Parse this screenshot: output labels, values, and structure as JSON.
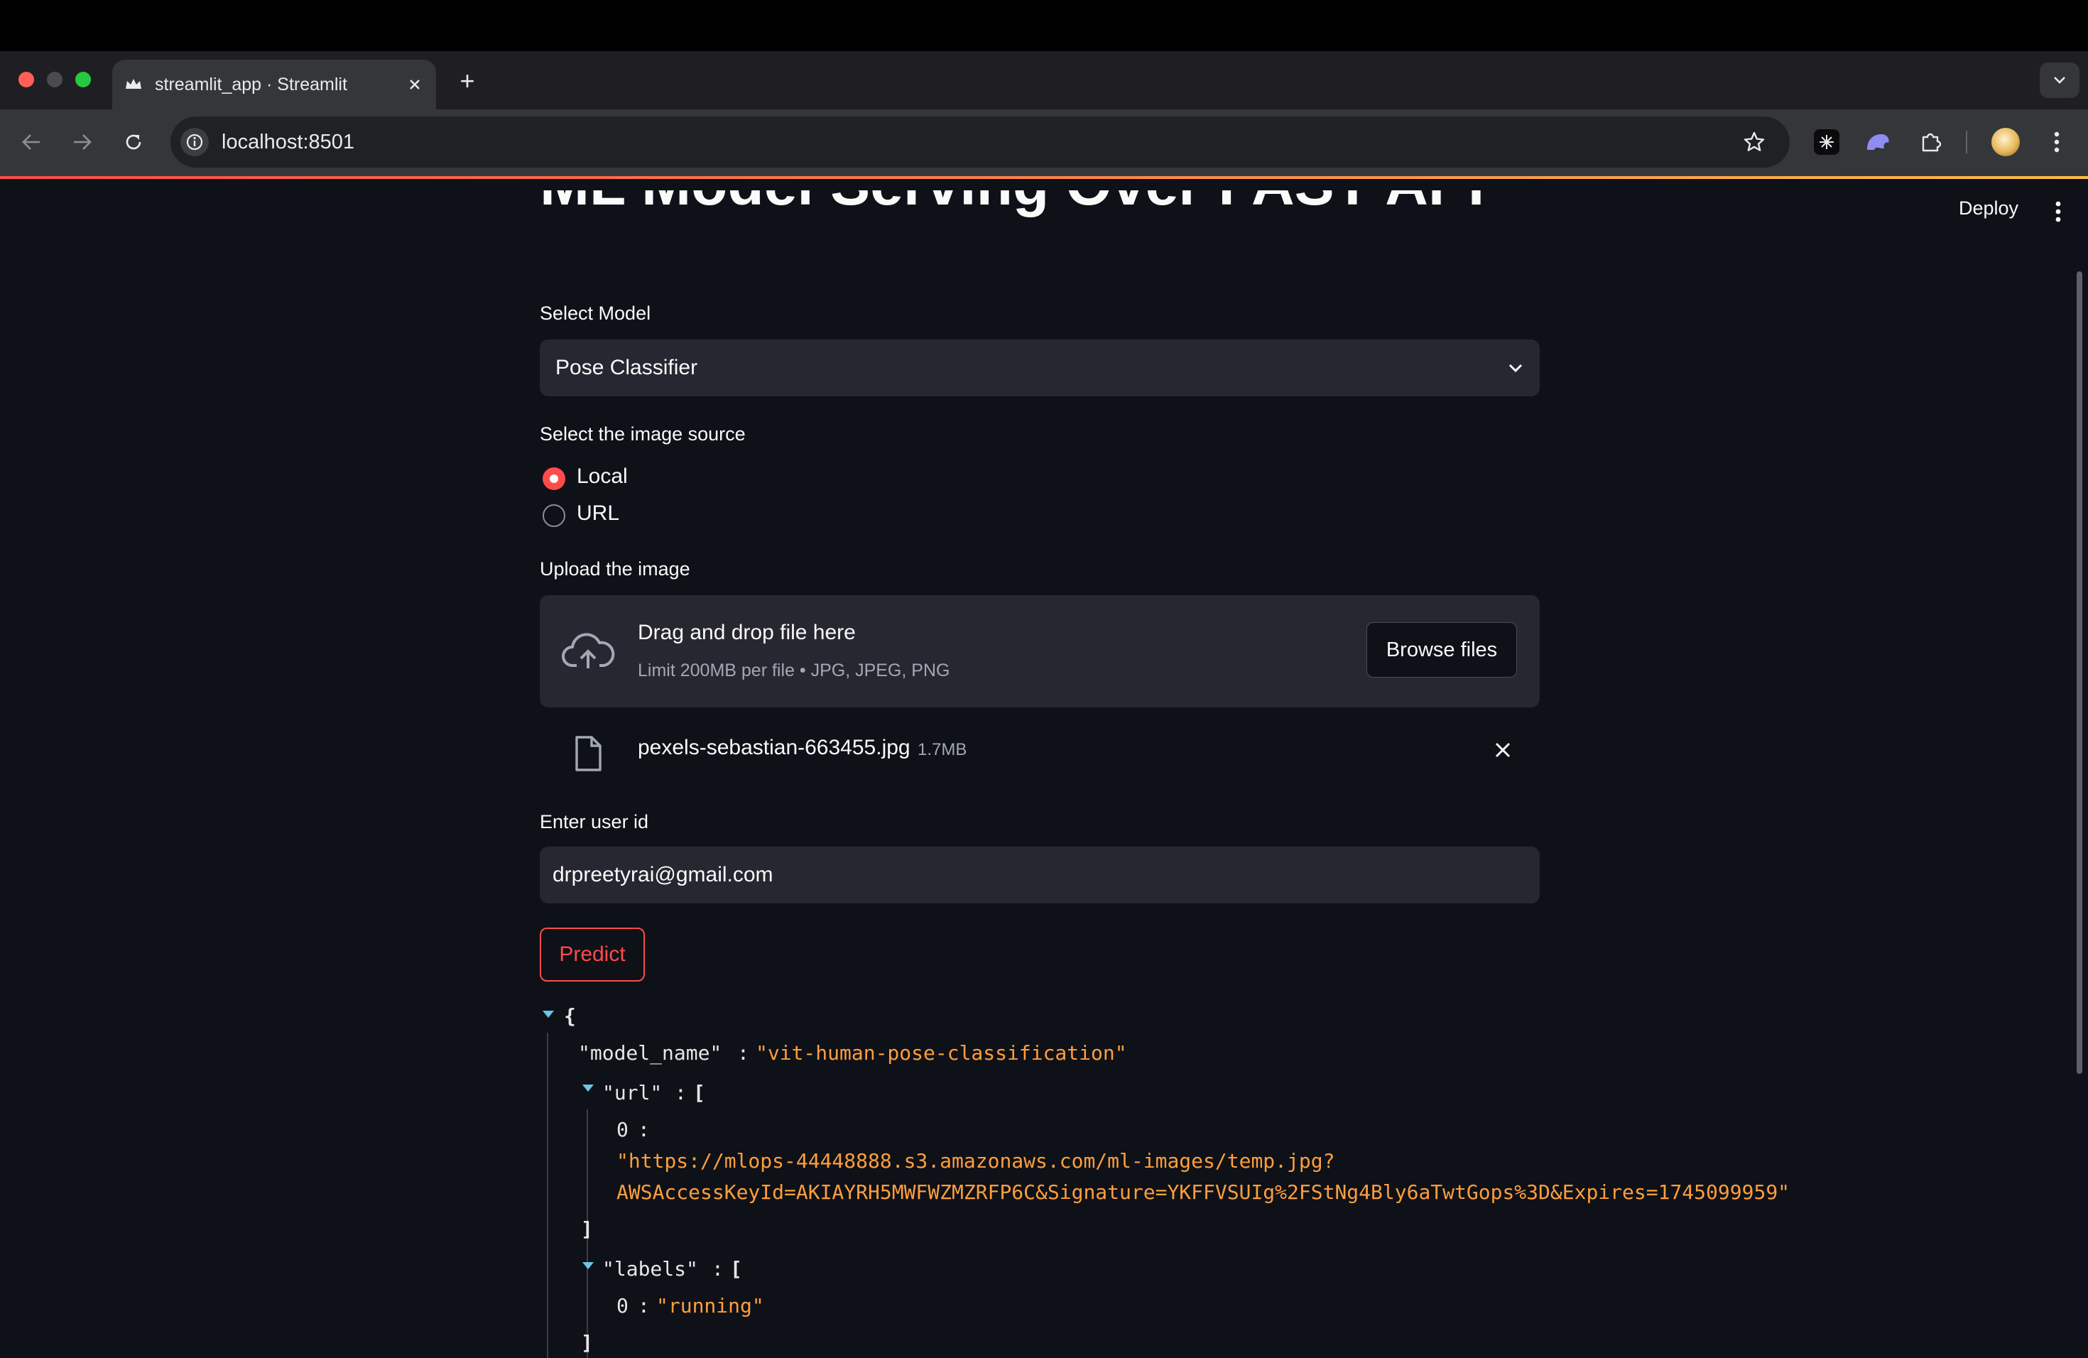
{
  "browser": {
    "tab_title": "streamlit_app · Streamlit",
    "new_tab_symbol": "+",
    "address": "localhost:8501",
    "icons": [
      "close-window-icon",
      "minimize-window-icon",
      "maximize-window-icon",
      "streamlit-crown-icon",
      "close-tab-icon",
      "new-tab-icon",
      "tab-search-icon",
      "back-icon",
      "forward-icon",
      "reload-icon",
      "site-info-icon",
      "bookmark-star-icon",
      "extension-icon",
      "extensions-puzzle-icon",
      "profile-avatar",
      "browser-menu-icon"
    ]
  },
  "header": {
    "deploy_label": "Deploy"
  },
  "app": {
    "title": "ML Model Serving Over FAST API",
    "select_model_label": "Select Model",
    "select_model_value": "Pose Classifier",
    "image_source_label": "Select the image source",
    "radio_options": [
      "Local",
      "URL"
    ],
    "radio_selected": "Local",
    "upload_label": "Upload the image",
    "dropzone_title": "Drag and drop file here",
    "dropzone_hint": "Limit 200MB per file • JPG, JPEG, PNG",
    "browse_button": "Browse files",
    "uploaded_file_name": "pexels-sebastian-663455.jpg",
    "uploaded_file_size": "1.7MB",
    "user_id_label": "Enter user id",
    "user_id_value": "drpreetyrai@gmail.com",
    "predict_button": "Predict"
  },
  "json_view": {
    "open_brace": "{",
    "model_name_key": "\"model_name\"",
    "model_name_value": "\"vit-human-pose-classification\"",
    "url_key": "\"url\"",
    "url_index": "0",
    "url_value_line1": "\"https://mlops-44448888.s3.amazonaws.com/ml-images/temp.jpg?",
    "url_value_line2": "AWSAccessKeyId=AKIAYRH5MWFWZMZRFP6C&Signature=YKFFVSUIg%2FStNg4Bly6aTwtGops%3D&Expires=1745099959\"",
    "labels_key": "\"labels\"",
    "labels_index": "0",
    "labels_value": "\"running\"",
    "colon": ":",
    "open_bracket": "[",
    "close_bracket": "]"
  },
  "colors": {
    "accent": "#ff4b4b",
    "string": "#ff9e3d",
    "background": "#0e1117",
    "input": "#262730"
  }
}
